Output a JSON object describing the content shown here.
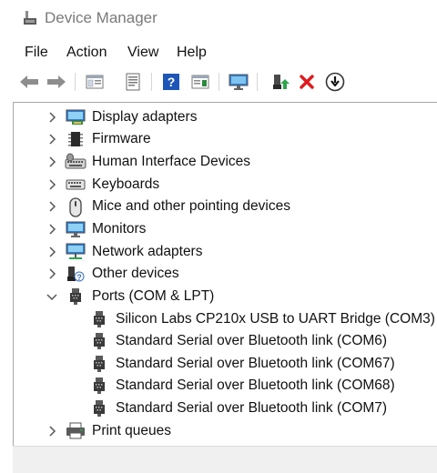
{
  "window": {
    "title": "Device Manager",
    "icon": "device-manager-icon"
  },
  "menu": [
    "File",
    "Action",
    "View",
    "Help"
  ],
  "toolbar": {
    "buttons": [
      "back-arrow-icon",
      "forward-arrow-icon",
      "show-hide-console-tree-icon",
      "properties-icon",
      "help-icon",
      "action-pane-icon",
      "computer-monitor-icon",
      "update-driver-icon",
      "uninstall-device-icon",
      "disable-device-icon"
    ]
  },
  "tree": {
    "nodes": [
      {
        "label": "Display adapters",
        "icon": "display-adapter-icon",
        "expanded": false
      },
      {
        "label": "Firmware",
        "icon": "firmware-chip-icon",
        "expanded": false
      },
      {
        "label": "Human Interface Devices",
        "icon": "hid-icon",
        "expanded": false
      },
      {
        "label": "Keyboards",
        "icon": "keyboard-icon",
        "expanded": false
      },
      {
        "label": "Mice and other pointing devices",
        "icon": "mouse-icon",
        "expanded": false
      },
      {
        "label": "Monitors",
        "icon": "monitor-icon",
        "expanded": false
      },
      {
        "label": "Network adapters",
        "icon": "network-adapter-icon",
        "expanded": false
      },
      {
        "label": "Other devices",
        "icon": "unknown-device-icon",
        "expanded": false
      },
      {
        "label": "Ports (COM & LPT)",
        "icon": "port-icon",
        "expanded": true
      },
      {
        "label": "Silicon Labs CP210x USB to UART Bridge (COM3)",
        "icon": "port-icon",
        "child": true
      },
      {
        "label": "Standard Serial over Bluetooth link (COM6)",
        "icon": "port-icon",
        "child": true
      },
      {
        "label": "Standard Serial over Bluetooth link (COM67)",
        "icon": "port-icon",
        "child": true
      },
      {
        "label": "Standard Serial over Bluetooth link (COM68)",
        "icon": "port-icon",
        "child": true
      },
      {
        "label": "Standard Serial over Bluetooth link (COM7)",
        "icon": "port-icon",
        "child": true
      },
      {
        "label": "Print queues",
        "icon": "printer-icon",
        "expanded": false
      }
    ]
  },
  "colors": {
    "accent_blue": "#1e6fc9",
    "delete_red": "#e0191c",
    "update_green": "#2da44e",
    "title_gray": "#7a7a7a"
  }
}
